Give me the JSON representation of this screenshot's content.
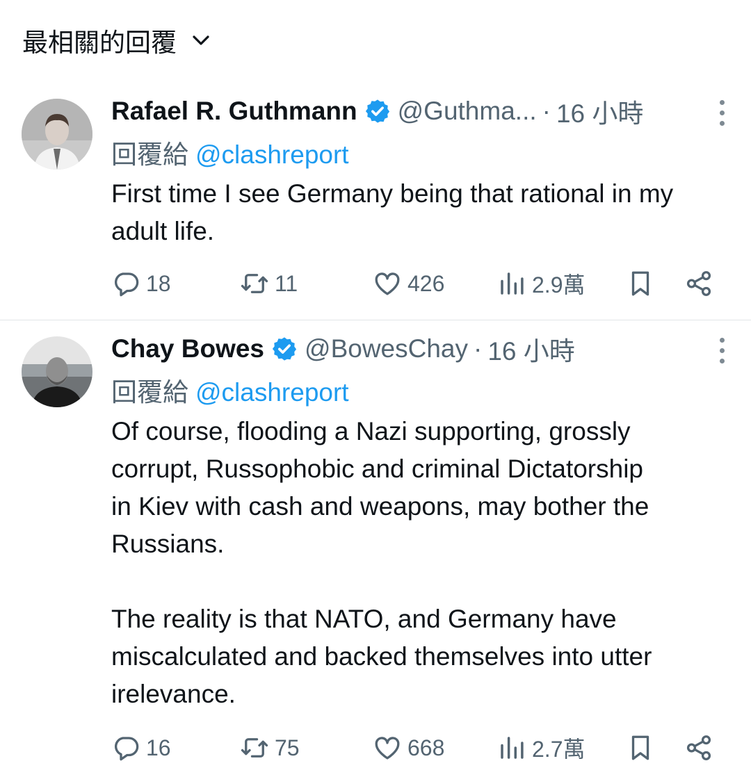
{
  "header": {
    "sort_label": "最相關的回覆"
  },
  "colors": {
    "accent": "#1d9bf0",
    "secondary_text": "#536471",
    "primary_text": "#0f1419"
  },
  "replies": [
    {
      "display_name": "Rafael R. Guthmann",
      "handle": "@Guthma...",
      "separator": "·",
      "time": "16 小時",
      "reply_to_prefix": "回覆給",
      "reply_to_handle": "@clashreport",
      "text": "First time I see Germany being that rational in my\nadult life.",
      "stats": {
        "replies": "18",
        "retweets": "11",
        "likes": "426",
        "views": "2.9萬"
      }
    },
    {
      "display_name": "Chay Bowes",
      "handle": "@BowesChay",
      "separator": "·",
      "time": "16 小時",
      "reply_to_prefix": "回覆給",
      "reply_to_handle": "@clashreport",
      "text": "Of course, flooding a Nazi supporting, grossly\ncorrupt, Russophobic and criminal Dictatorship\nin Kiev with cash and weapons, may bother the\nRussians.\n\nThe reality is that NATO, and Germany have\nmiscalculated and backed themselves into utter\nirelevance.",
      "stats": {
        "replies": "16",
        "retweets": "75",
        "likes": "668",
        "views": "2.7萬"
      }
    }
  ]
}
